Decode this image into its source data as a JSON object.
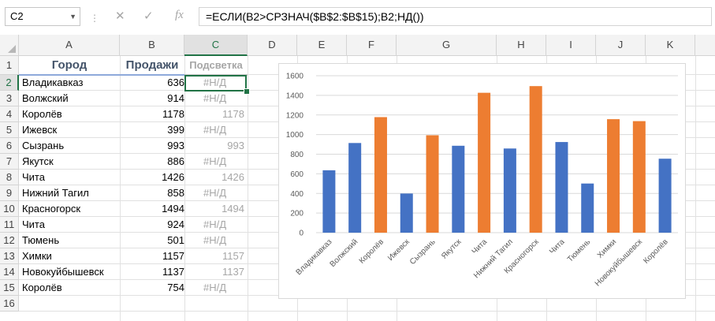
{
  "formula_bar": {
    "name_box": "C2",
    "formula": "=ЕСЛИ(B2>СРЗНАЧ($B$2:$B$15);B2;НД())"
  },
  "columns": [
    "A",
    "B",
    "C",
    "D",
    "E",
    "F",
    "G",
    "H",
    "I",
    "J",
    "K"
  ],
  "rows": [
    "1",
    "2",
    "3",
    "4",
    "5",
    "6",
    "7",
    "8",
    "9",
    "10",
    "11",
    "12",
    "13",
    "14",
    "15",
    "16"
  ],
  "headers": {
    "city": "Город",
    "sales": "Продажи",
    "highlight": "Подсветка"
  },
  "table": [
    {
      "city": "Владикавказ",
      "sales": "636",
      "highlight": "#Н/Д"
    },
    {
      "city": "Волжский",
      "sales": "914",
      "highlight": "#Н/Д"
    },
    {
      "city": "Королёв",
      "sales": "1178",
      "highlight": "1178"
    },
    {
      "city": "Ижевск",
      "sales": "399",
      "highlight": "#Н/Д"
    },
    {
      "city": "Сызрань",
      "sales": "993",
      "highlight": "993"
    },
    {
      "city": "Якутск",
      "sales": "886",
      "highlight": "#Н/Д"
    },
    {
      "city": "Чита",
      "sales": "1426",
      "highlight": "1426"
    },
    {
      "city": "Нижний Тагил",
      "sales": "858",
      "highlight": "#Н/Д"
    },
    {
      "city": "Красногорск",
      "sales": "1494",
      "highlight": "1494"
    },
    {
      "city": "Чита",
      "sales": "924",
      "highlight": "#Н/Д"
    },
    {
      "city": "Тюмень",
      "sales": "501",
      "highlight": "#Н/Д"
    },
    {
      "city": "Химки",
      "sales": "1157",
      "highlight": "1157"
    },
    {
      "city": "Новокуйбышевск",
      "sales": "1137",
      "highlight": "1137"
    },
    {
      "city": "Королёв",
      "sales": "754",
      "highlight": "#Н/Д"
    }
  ],
  "colors": {
    "blue": "#4472c4",
    "orange": "#ed7d31",
    "excel_green": "#217346"
  },
  "chart_data": {
    "type": "bar",
    "categories": [
      "Владикавказ",
      "Волжский",
      "Королёв",
      "Ижевск",
      "Сызрань",
      "Якутск",
      "Чита",
      "Нижний Тагил",
      "Красногорск",
      "Чита",
      "Тюмень",
      "Химки",
      "Новокуйбышевск",
      "Королёв"
    ],
    "series": [
      {
        "values": [
          636,
          914,
          1178,
          399,
          993,
          886,
          1426,
          858,
          1494,
          924,
          501,
          1157,
          1137,
          754
        ],
        "color": "#4472c4"
      },
      {
        "values": [
          null,
          null,
          1178,
          null,
          993,
          null,
          1426,
          null,
          1494,
          null,
          null,
          1157,
          1137,
          null
        ],
        "color": "#ed7d31"
      }
    ],
    "ylim": [
      0,
      1600
    ],
    "yticks": [
      0,
      200,
      400,
      600,
      800,
      1000,
      1200,
      1400,
      1600
    ],
    "grid": true,
    "title": "",
    "xlabel": "",
    "ylabel": ""
  }
}
